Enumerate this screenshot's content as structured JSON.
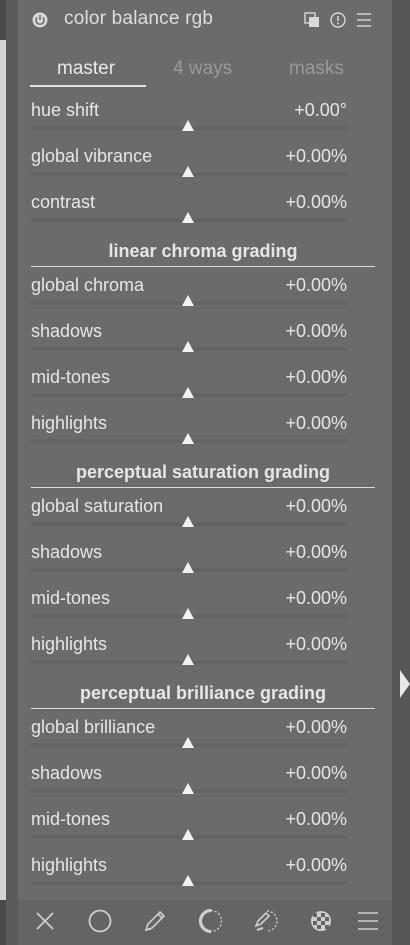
{
  "module": {
    "title": "color balance rgb",
    "header_icons": [
      "power-icon",
      "presets-icon",
      "reset-icon",
      "menu-icon"
    ]
  },
  "tabs": [
    {
      "label": "master",
      "active": true
    },
    {
      "label": "4 ways",
      "active": false
    },
    {
      "label": "masks",
      "active": false
    }
  ],
  "master": {
    "rows": [
      {
        "label": "hue shift",
        "value": "+0.00°"
      },
      {
        "label": "global vibrance",
        "value": "+0.00%"
      },
      {
        "label": "contrast",
        "value": "+0.00%"
      }
    ]
  },
  "sections": [
    {
      "title": "linear chroma grading",
      "rows": [
        {
          "label": "global chroma",
          "value": "+0.00%"
        },
        {
          "label": "shadows",
          "value": "+0.00%"
        },
        {
          "label": "mid-tones",
          "value": "+0.00%"
        },
        {
          "label": "highlights",
          "value": "+0.00%"
        }
      ]
    },
    {
      "title": "perceptual saturation grading",
      "rows": [
        {
          "label": "global saturation",
          "value": "+0.00%"
        },
        {
          "label": "shadows",
          "value": "+0.00%"
        },
        {
          "label": "mid-tones",
          "value": "+0.00%"
        },
        {
          "label": "highlights",
          "value": "+0.00%"
        }
      ]
    },
    {
      "title": "perceptual brilliance grading",
      "rows": [
        {
          "label": "global brilliance",
          "value": "+0.00%"
        },
        {
          "label": "shadows",
          "value": "+0.00%"
        },
        {
          "label": "mid-tones",
          "value": "+0.00%"
        },
        {
          "label": "highlights",
          "value": "+0.00%"
        }
      ]
    }
  ],
  "footer_icons": [
    "close-icon",
    "circle-icon",
    "pencil-icon",
    "parametric-mask-icon",
    "drawn-parametric-mask-icon",
    "raster-mask-icon",
    "menu-icon"
  ]
}
